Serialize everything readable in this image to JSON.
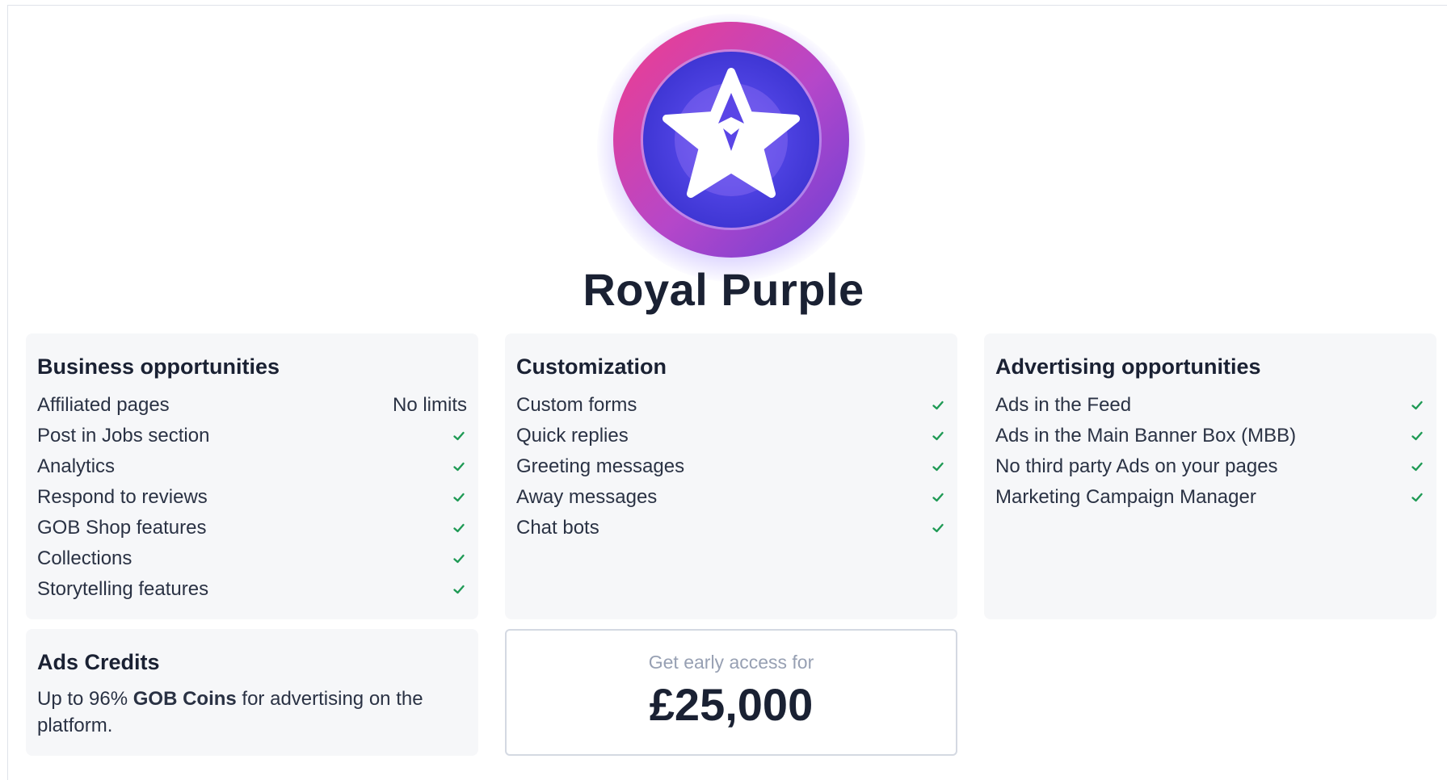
{
  "plan": {
    "name": "Royal Purple",
    "badge_icon": "royal-purple-star-icon"
  },
  "cards": {
    "business": {
      "title": "Business opportunities",
      "items": [
        {
          "label": "Affiliated pages",
          "value": "No limits"
        },
        {
          "label": "Post in Jobs section",
          "value": "check"
        },
        {
          "label": "Analytics",
          "value": "check"
        },
        {
          "label": "Respond to reviews",
          "value": "check"
        },
        {
          "label": "GOB Shop features",
          "value": "check"
        },
        {
          "label": "Collections",
          "value": "check"
        },
        {
          "label": "Storytelling features",
          "value": "check"
        }
      ]
    },
    "customization": {
      "title": "Customization",
      "items": [
        {
          "label": "Custom forms",
          "value": "check"
        },
        {
          "label": "Quick replies",
          "value": "check"
        },
        {
          "label": "Greeting messages",
          "value": "check"
        },
        {
          "label": "Away messages",
          "value": "check"
        },
        {
          "label": "Chat bots",
          "value": "check"
        }
      ]
    },
    "advertising": {
      "title": "Advertising opportunities",
      "items": [
        {
          "label": "Ads in the Feed",
          "value": "check"
        },
        {
          "label": "Ads in the Main Banner Box (MBB)",
          "value": "check"
        },
        {
          "label": "No third party Ads on your pages",
          "value": "check"
        },
        {
          "label": "Marketing Campaign Manager",
          "value": "check"
        }
      ]
    },
    "ads_credits": {
      "title": "Ads Credits",
      "text_before": "Up to 96% ",
      "text_bold": "GOB Coins",
      "text_after": " for advertising on the platform."
    }
  },
  "pricing": {
    "label": "Get early access for",
    "price": "£25,000"
  },
  "colors": {
    "check": "#1f9a55",
    "card_bg": "#f6f7f9",
    "badge_pink": "#ef3f8f",
    "badge_purple": "#7a3fd6",
    "badge_inner": "#4b3fe0"
  }
}
